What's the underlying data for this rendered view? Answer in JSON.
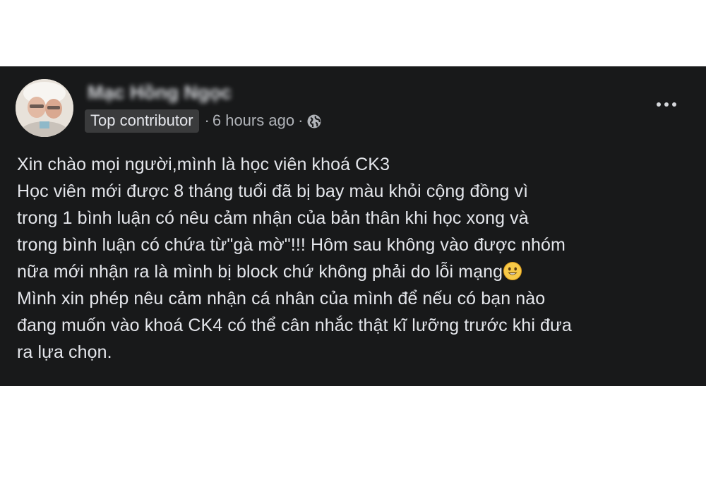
{
  "post": {
    "author_name": "Mạc Hồng Ngọc",
    "badge": "Top contributor",
    "separator": "·",
    "time": "6 hours ago",
    "privacy_icon": "globe-icon",
    "menu_icon": "more-horizontal-icon",
    "body_lines": [
      "Xin chào mọi người,mình là học viên khoá CK3",
      "Học viên mới được 8 tháng tuổi đã bị bay màu khỏi cộng đồng vì",
      "trong 1 bình luận có nêu cảm nhận của bản thân khi học xong và",
      "trong bình luận có chứa từ\"gà mờ\"!!! Hôm sau không vào được nhóm",
      "nữa mới nhận ra là mình bị block chứ không phải do lỗi mạng",
      "Mình xin phép nêu cảm nhận cá nhân của mình để nếu có bạn nào",
      "đang muốn vào khoá CK4 có thể cân nhắc thật kĩ lưỡng trước khi đưa",
      "ra lựa chọn."
    ],
    "emoji_icon": "smiley-emoji-icon"
  },
  "colors": {
    "card_background": "#18191a",
    "text_primary": "#e4e6eb",
    "text_secondary": "#b0b3b8",
    "badge_background": "#3a3b3c"
  }
}
